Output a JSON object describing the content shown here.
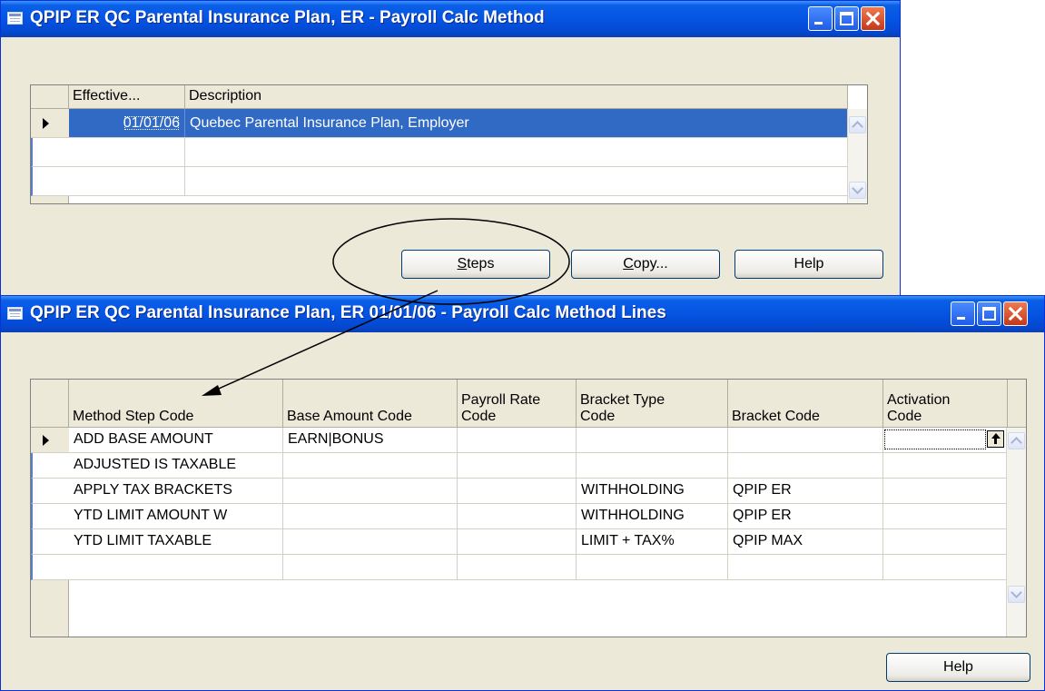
{
  "window1": {
    "title": "QPIP ER QC Parental Insurance Plan, ER - Payroll Calc Method",
    "columns": [
      "Effective...",
      "Description"
    ],
    "rows": [
      {
        "effective": "01/01/06",
        "description": "Quebec Parental Insurance Plan, Employer"
      },
      {
        "effective": "",
        "description": ""
      },
      {
        "effective": "",
        "description": ""
      }
    ],
    "buttons": {
      "steps": "Steps",
      "copy": "Copy...",
      "help": "Help"
    }
  },
  "window2": {
    "title": "QPIP ER QC Parental Insurance Plan, ER 01/01/06 - Payroll Calc Method Lines",
    "columns": [
      "Method Step Code",
      "Base Amount Code",
      "Payroll Rate Code",
      "Bracket Type Code",
      "Bracket Code",
      "Activation Code"
    ],
    "column_lines": [
      [
        "Method Step Code"
      ],
      [
        "Base Amount Code"
      ],
      [
        "Payroll Rate",
        "Code"
      ],
      [
        "Bracket Type",
        "Code"
      ],
      [
        "Bracket Code"
      ],
      [
        "Activation",
        "Code"
      ]
    ],
    "rows": [
      {
        "method_step_code": "ADD BASE AMOUNT",
        "base_amount_code": "EARN|BONUS",
        "payroll_rate_code": "",
        "bracket_type_code": "",
        "bracket_code": "",
        "activation_code": ""
      },
      {
        "method_step_code": "ADJUSTED IS TAXABLE",
        "base_amount_code": "",
        "payroll_rate_code": "",
        "bracket_type_code": "",
        "bracket_code": "",
        "activation_code": ""
      },
      {
        "method_step_code": "APPLY TAX BRACKETS",
        "base_amount_code": "",
        "payroll_rate_code": "",
        "bracket_type_code": "WITHHOLDING",
        "bracket_code": "QPIP ER",
        "activation_code": ""
      },
      {
        "method_step_code": "YTD LIMIT AMOUNT W",
        "base_amount_code": "",
        "payroll_rate_code": "",
        "bracket_type_code": "WITHHOLDING",
        "bracket_code": "QPIP ER",
        "activation_code": ""
      },
      {
        "method_step_code": "YTD LIMIT TAXABLE",
        "base_amount_code": "",
        "payroll_rate_code": "",
        "bracket_type_code": "LIMIT + TAX%",
        "bracket_code": "QPIP MAX",
        "activation_code": ""
      },
      {
        "method_step_code": "",
        "base_amount_code": "",
        "payroll_rate_code": "",
        "bracket_type_code": "",
        "bracket_code": "",
        "activation_code": ""
      }
    ],
    "buttons": {
      "help": "Help"
    }
  },
  "colors": {
    "titlebar": "#0554e3",
    "selection": "#316ac5",
    "face": "#ece9d8",
    "close": "#c4381a"
  },
  "icons": [
    "window-icon",
    "minimize-icon",
    "maximize-icon",
    "close-icon",
    "row-pointer-icon",
    "scroll-up-icon",
    "scroll-down-icon",
    "lookup-arrow-icon"
  ]
}
